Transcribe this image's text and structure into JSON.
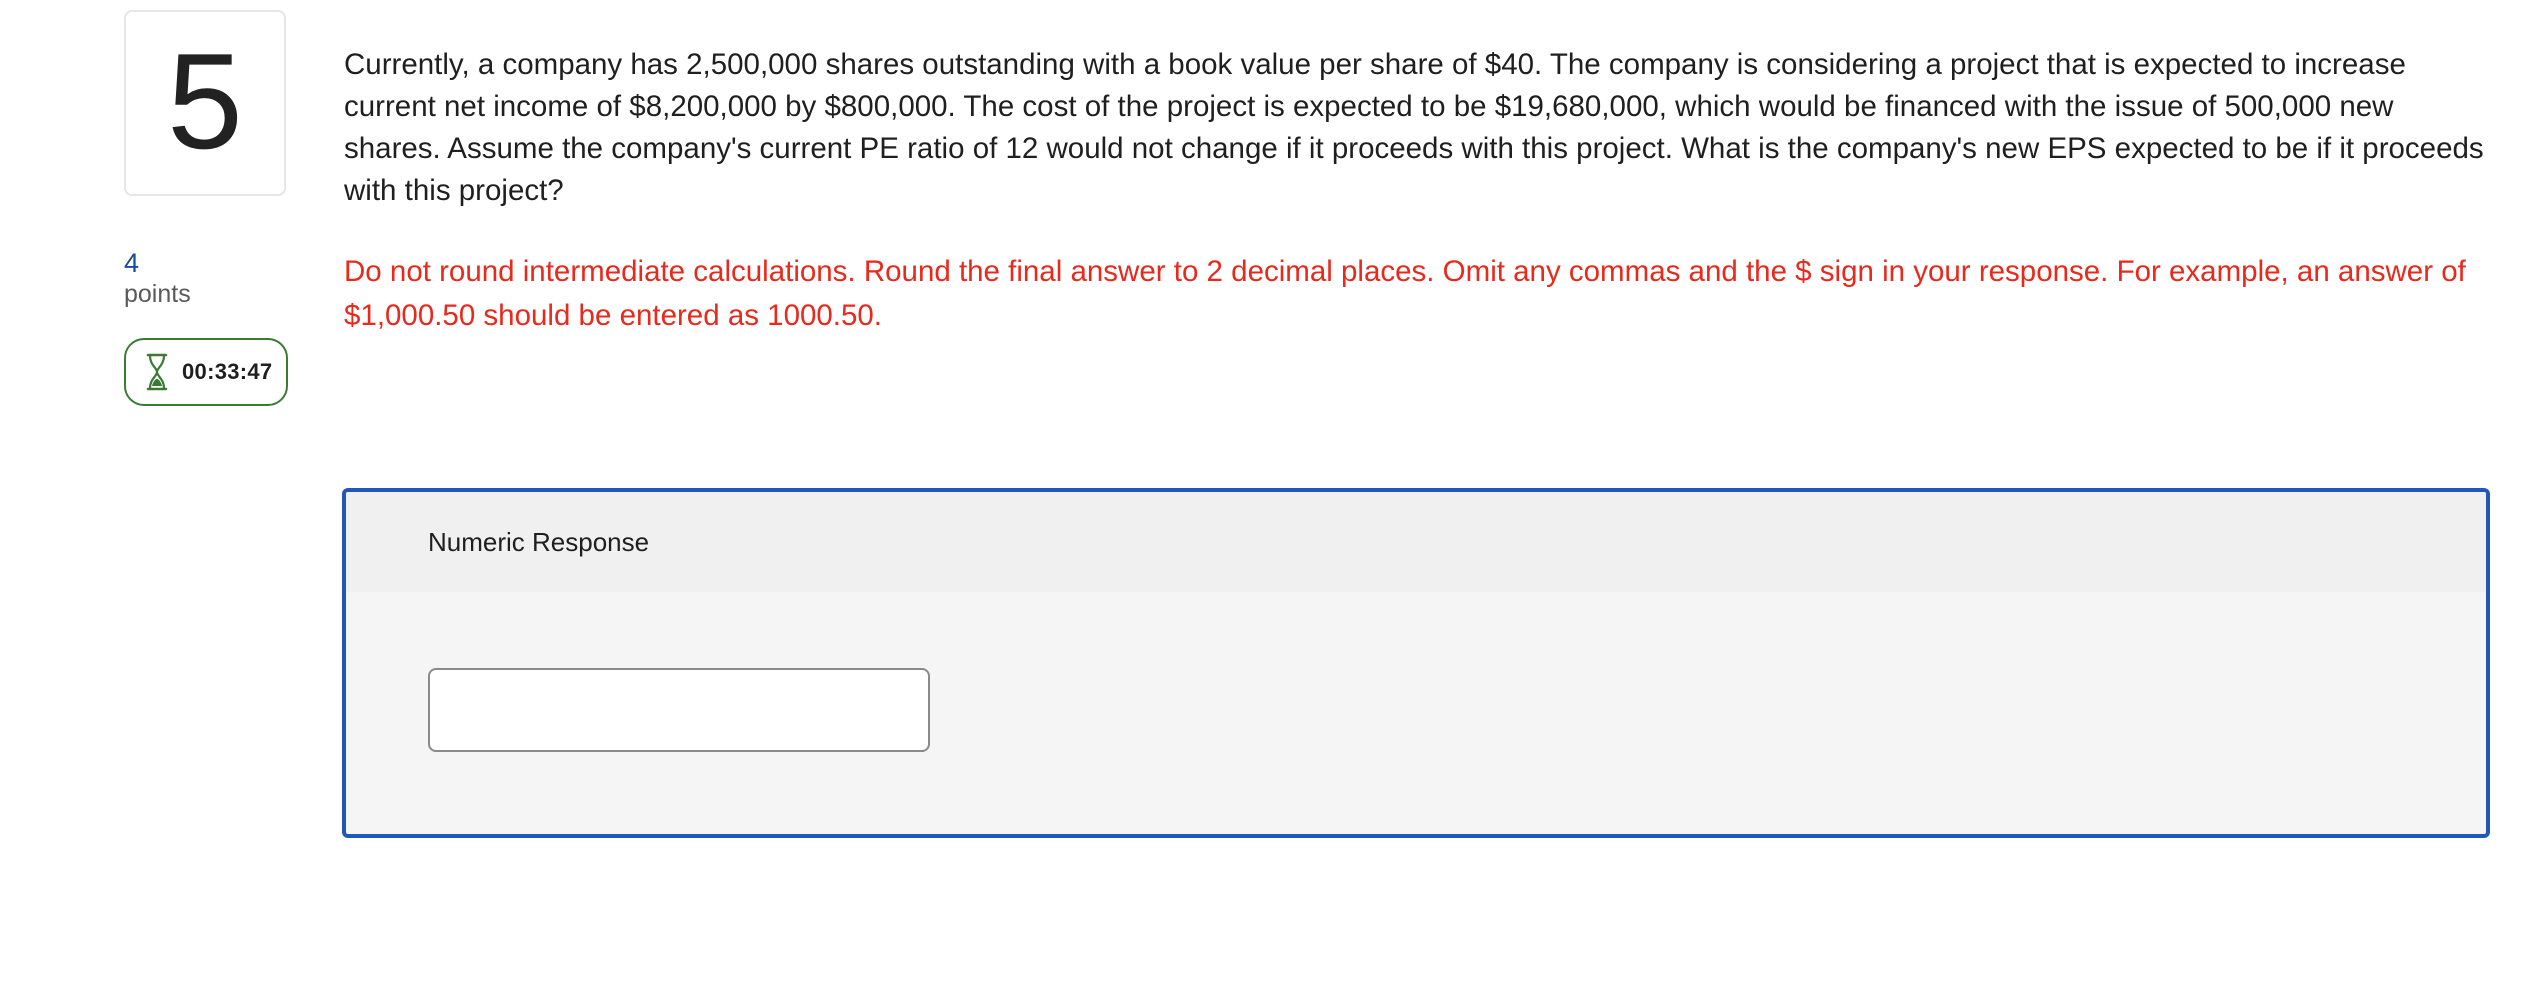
{
  "question": {
    "number": "5",
    "points_value": "4",
    "points_label": "points",
    "timer": "00:33:47",
    "text": "Currently, a company has 2,500,000 shares outstanding with a book value per share of $40. The company is considering a project that is expected to increase current net income of $8,200,000 by $800,000. The cost of the project is expected to be $19,680,000, which would be financed with the issue of 500,000 new shares. Assume the company's current PE ratio of 12 would not change if it proceeds with this project. What is the company's new EPS expected to be if it proceeds with this project?",
    "instructions": "Do not round intermediate calculations. Round the final answer to 2 decimal places. Omit any commas and the $ sign in your response. For example, an answer of $1,000.50 should be entered as 1000.50."
  },
  "response": {
    "label": "Numeric Response",
    "value": ""
  },
  "icons": {
    "timer": "hourglass-icon"
  },
  "colors": {
    "instruction_text": "#e8291c",
    "panel_border": "#2157b8",
    "timer_border": "#3a7a34",
    "points_value": "#1a4a9e"
  }
}
